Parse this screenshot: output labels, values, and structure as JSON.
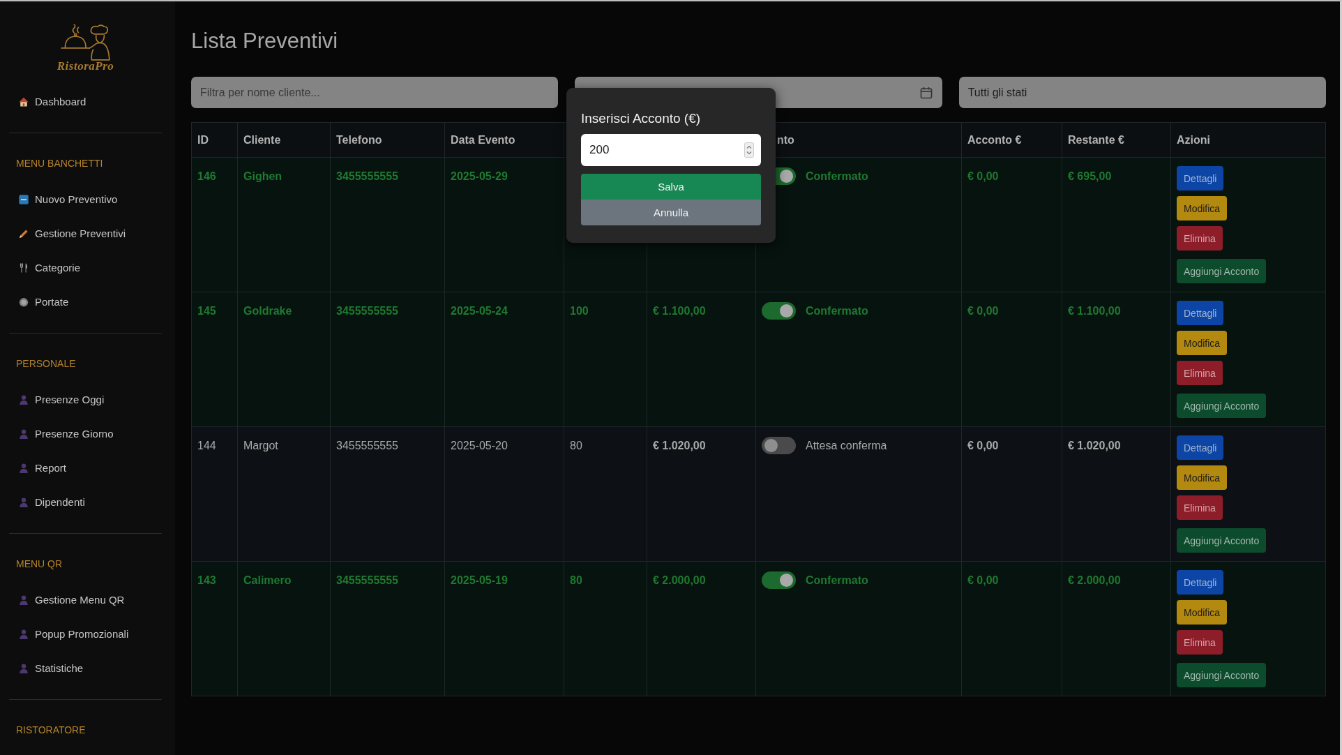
{
  "sidebar": {
    "logo_text": "RistoraPro",
    "sections": [
      {
        "items": [
          {
            "label": "Dashboard",
            "kind": "home"
          }
        ]
      },
      {
        "title": "MENU BANCHETTI",
        "items": [
          {
            "label": "Nuovo Preventivo",
            "kind": "new"
          },
          {
            "label": "Gestione Preventivi",
            "kind": "pencil"
          },
          {
            "label": "Categorie",
            "kind": "cutlery"
          },
          {
            "label": "Portate",
            "kind": "plate"
          }
        ]
      },
      {
        "title": "PERSONALE",
        "items": [
          {
            "label": "Presenze Oggi",
            "kind": "person"
          },
          {
            "label": "Presenze Giorno",
            "kind": "person"
          },
          {
            "label": "Report",
            "kind": "person"
          },
          {
            "label": "Dipendenti",
            "kind": "person"
          }
        ]
      },
      {
        "title": "MENU QR",
        "items": [
          {
            "label": "Gestione Menu QR",
            "kind": "person"
          },
          {
            "label": "Popup Promozionali",
            "kind": "person"
          },
          {
            "label": "Statistiche",
            "kind": "person"
          }
        ]
      },
      {
        "title": "RISTORATORE"
      }
    ]
  },
  "page_title": "Lista Preventivi",
  "filters": [
    {
      "kind": "text",
      "placeholder": "Filtra per nome cliente..."
    },
    {
      "kind": "date"
    },
    {
      "kind": "select",
      "value": "Tutti gli stati"
    }
  ],
  "table": {
    "columns": [
      {
        "label": "ID"
      },
      {
        "label": "Cliente"
      },
      {
        "label": "Telefono"
      },
      {
        "label": "Data Evento"
      },
      {},
      {},
      {
        "label": "nto"
      },
      {
        "label": "Acconto €"
      },
      {
        "label": "Restante €"
      },
      {
        "label": "Azioni"
      }
    ],
    "rows": [
      {
        "id": "146",
        "cliente": "Gighen",
        "telefono": "3455555555",
        "data_evento": "2025-05-29",
        "confirmed": true,
        "column_7": "Confermato",
        "acconto": "€ 0,00",
        "restante": "€ 695,00",
        "actions": [
          {
            "label": "Dettagli",
            "kind": "info"
          },
          {
            "label": "Modifica",
            "kind": "warning"
          },
          {
            "label": "Elimina",
            "kind": "danger"
          },
          {
            "label": "Aggiungi Acconto",
            "kind": "success"
          }
        ]
      },
      {
        "id": "145",
        "cliente": "Goldrake",
        "telefono": "3455555555",
        "data_evento": "2025-05-24",
        "column_5": "100",
        "column_6": "€ 1.100,00",
        "confirmed": true,
        "column_7": "Confermato",
        "acconto": "€ 0,00",
        "restante": "€ 1.100,00",
        "actions": [
          {
            "label": "Dettagli",
            "kind": "info"
          },
          {
            "label": "Modifica",
            "kind": "warning"
          },
          {
            "label": "Elimina",
            "kind": "danger"
          },
          {
            "label": "Aggiungi Acconto",
            "kind": "success"
          }
        ]
      },
      {
        "id": "144",
        "cliente": "Margot",
        "telefono": "3455555555",
        "data_evento": "2025-05-20",
        "column_5": "80",
        "column_6": "€ 1.020,00",
        "confirmed": false,
        "column_7": "Attesa conferma",
        "acconto": "€ 0,00",
        "restante": "€ 1.020,00",
        "actions": [
          {
            "label": "Dettagli",
            "kind": "info"
          },
          {
            "label": "Modifica",
            "kind": "warning"
          },
          {
            "label": "Elimina",
            "kind": "danger"
          },
          {
            "label": "Aggiungi Acconto",
            "kind": "success"
          }
        ]
      },
      {
        "id": "143",
        "cliente": "Calimero",
        "telefono": "3455555555",
        "data_evento": "2025-05-19",
        "column_5": "80",
        "column_6": "€ 2.000,00",
        "confirmed": true,
        "column_7": "Confermato",
        "acconto": "€ 0,00",
        "restante": "€ 2.000,00",
        "actions": [
          {
            "label": "Dettagli",
            "kind": "info"
          },
          {
            "label": "Modifica",
            "kind": "warning"
          },
          {
            "label": "Elimina",
            "kind": "danger"
          },
          {
            "label": "Aggiungi Acconto",
            "kind": "success"
          }
        ]
      }
    ]
  },
  "dialog": {
    "title": "Inserisci Acconto (€)",
    "value": "200",
    "buttons": [
      {
        "label": "Salva",
        "kind": "primary"
      },
      {
        "label": "Annulla",
        "kind": "secondary"
      }
    ]
  }
}
